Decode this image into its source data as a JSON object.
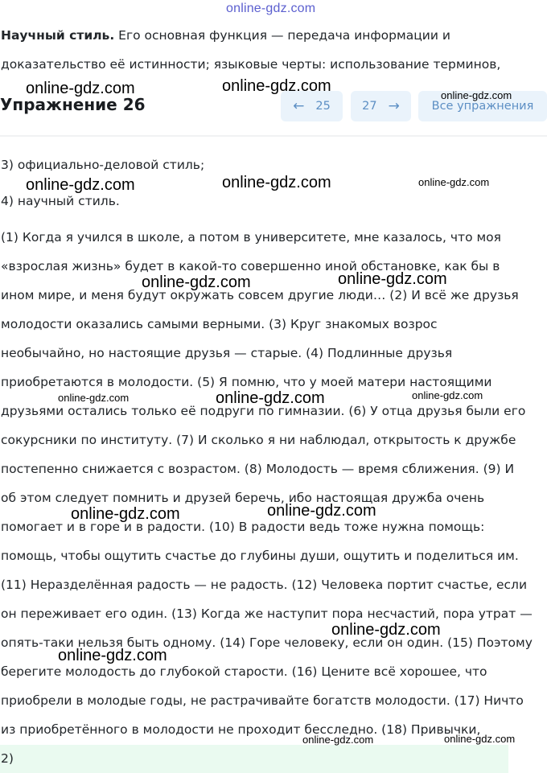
{
  "top_watermark": "online-gdz.com",
  "header": {
    "title": "Упражнение 26",
    "prev_label": "25",
    "next_label": "27",
    "all_label": "Все упражнения",
    "prev_icon": "arrow-left-icon",
    "next_icon": "arrow-right-icon"
  },
  "intro": {
    "bold": "Научный стиль.",
    "line1_rest": " Его основная функция — передача информации и",
    "line2": "доказательство её истинности; языковые черты: использование терминов,"
  },
  "options": {
    "line3": "3) официально-деловой стиль;",
    "line4": "4) научный стиль."
  },
  "text_lines": [
    "(1) Когда я учился в школе, а потом в университете, мне казалось, что моя",
    "«взрослая жизнь» будет в какой-то совершенно иной обстановке, как бы в",
    "ином мире, и меня будут окружать совсем другие люди… (2) И всё же друзья",
    "молодости оказались самыми верными. (3) Круг знакомых возрос",
    "необычайно, но настоящие друзья — старые. (4) Подлинные друзья",
    "приобретаются в молодости. (5) Я помню, что у моей матери настоящими",
    "друзьями остались только её подруги по гимназии. (6) У отца друзья были его",
    "сокурсники по институту. (7) И сколько я ни наблюдал, открытость к дружбе",
    "постепенно снижается с возрастом. (8) Молодость — время сближения. (9) И",
    "об этом следует помнить и друзей беречь, ибо настоящая дружба очень",
    "помогает и в горе и в радости. (10) В радости ведь тоже нужна помощь:",
    "помощь, чтобы ощутить счастье до глубины души, ощутить и поделиться им.",
    "(11) Неразделённая радость — не радость. (12) Человека портит счастье, если",
    "он переживает его один. (13) Когда же наступит пора несчастий, пора утрат —",
    "опять-таки нельзя быть одному. (14) Горе человеку, если он один. (15) Поэтому",
    "берегите молодость до глубокой старости. (16) Цените всё хорошее, что",
    "приобрели в молодые годы, не растрачивайте богатств молодости. (17) Ничто",
    "из приобретённого в молодости не проходит бесследно. (18) Привычки,"
  ],
  "answer": {
    "text": "2)"
  },
  "watermarks": [
    "online-gdz.com",
    "online-gdz.com",
    "online-gdz.com",
    "online-gdz.com",
    "online-gdz.com",
    "online-gdz.com",
    "online-gdz.com",
    "online-gdz.com",
    "online-gdz.com",
    "online-gdz.com",
    "online-gdz.com",
    "online-gdz.com",
    "online-gdz.com",
    "online-gdz.com",
    "online-gdz.com",
    "online-gdz.com",
    "online-gdz.com"
  ]
}
